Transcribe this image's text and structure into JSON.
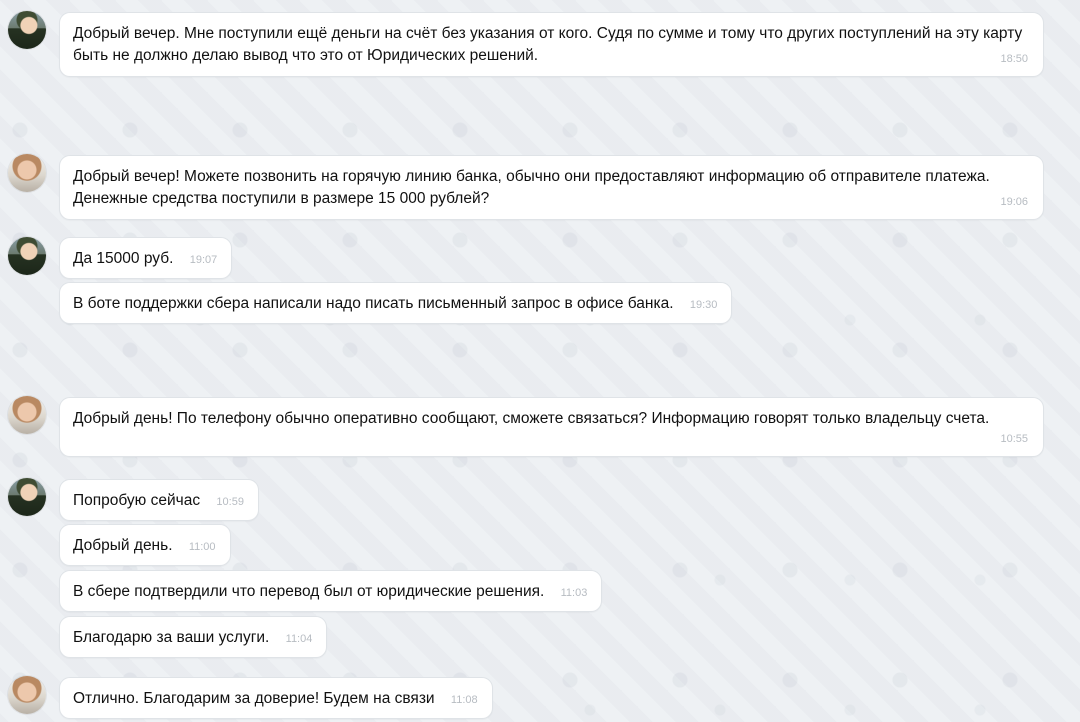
{
  "messages": [
    {
      "text": "Добрый вечер. Мне поступили ещё деньги на счёт без указания от кого. Судя по сумме и тому что других поступлений на эту карту быть не должно делаю вывод что это от Юридических решений.",
      "time": "18:50"
    },
    {
      "text": "Добрый вечер! Можете позвонить на горячую линию банка, обычно они предоставляют информацию об отправителе платежа. Денежные средства поступили в размере 15 000 рублей?",
      "time": "19:06"
    },
    {
      "text": "Да 15000 руб.",
      "time": "19:07"
    },
    {
      "text": "В боте поддержки сбера написали надо писать письменный запрос в офисе банка.",
      "time": "19:30"
    },
    {
      "text": "Добрый день! По телефону обычно оперативно сообщают, сможете связаться? Информацию говорят только владельцу счета.",
      "time": "10:55"
    },
    {
      "text": "Попробую сейчас",
      "time": "10:59"
    },
    {
      "text": "Добрый день.",
      "time": "11:00"
    },
    {
      "text": "В сбере подтвердили что перевод был от юридические решения.",
      "time": "11:03"
    },
    {
      "text": "Благодарю за ваши услуги.",
      "time": "11:04"
    },
    {
      "text": "Отлично. Благодарим за доверие! Будем на связи",
      "time": "11:08"
    }
  ]
}
